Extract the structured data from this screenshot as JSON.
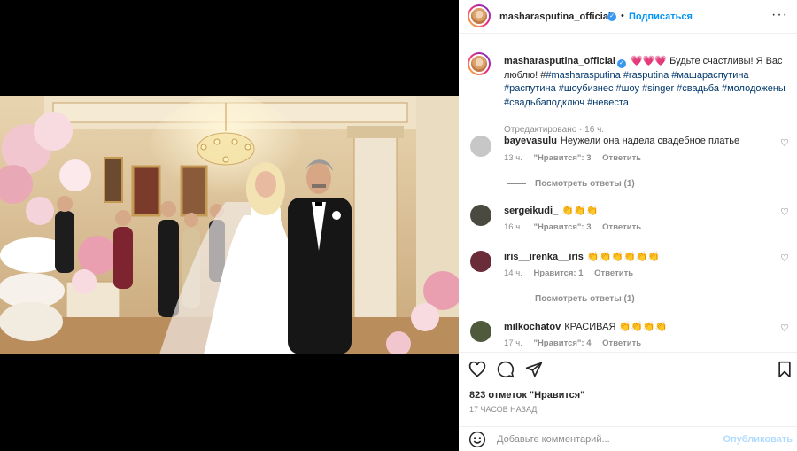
{
  "post": {
    "author": "masharasputina_official",
    "follow_label": "Подписаться",
    "dot": "•",
    "more": "···"
  },
  "caption": {
    "author": "masharasputina_official",
    "hearts": "💗💗💗",
    "text": " Будьте счастливы! Я Вас люблю! #",
    "tags": "#masharasputina #rasputina #машараспутина #распутина #шоубизнес #шоу #singer #свадьба #молодожены #свадьбаподключ #невеста",
    "edited": "Отредактировано · 16 ч."
  },
  "comments": [
    {
      "user": "bayevasulu",
      "text": "Неужели она надела свадебное платье",
      "time": "13 ч.",
      "likes": "\"Нравится\": 3",
      "reply": "Ответить",
      "avatar_color": "#c7c7c7"
    },
    {
      "user": "sergeikudi_",
      "text": "👏👏👏",
      "time": "16 ч.",
      "likes": "\"Нравится\": 3",
      "reply": "Ответить",
      "avatar_color": "#4a4a40"
    },
    {
      "user": "iris__irenka__iris",
      "text": "👏👏👏👏👏👏",
      "time": "14 ч.",
      "likes": "Нравится: 1",
      "reply": "Ответить",
      "avatar_color": "#6b2c3a"
    },
    {
      "user": "milkochatov",
      "text": "КРАСИВАЯ 👏👏👏👏",
      "time": "17 ч.",
      "likes": "\"Нравится\": 4",
      "reply": "Ответить",
      "avatar_color": "#4f5a3c"
    }
  ],
  "view_replies": "Посмотреть ответы (1)",
  "likes_count": "823 отметок \"Нравится\"",
  "posted_time": "17 часов назад",
  "comment_input": {
    "placeholder": "Добавьте комментарий..."
  },
  "publish_label": "Опубликовать",
  "icons": [
    "heart-icon",
    "comment-icon",
    "share-icon",
    "bookmark-icon",
    "emoji-icon",
    "verified-icon",
    "like-icon"
  ],
  "colors": {
    "link": "#0095f6",
    "hashtag": "#00376b",
    "muted": "#8e8e8e",
    "verified": "#3897f0"
  }
}
